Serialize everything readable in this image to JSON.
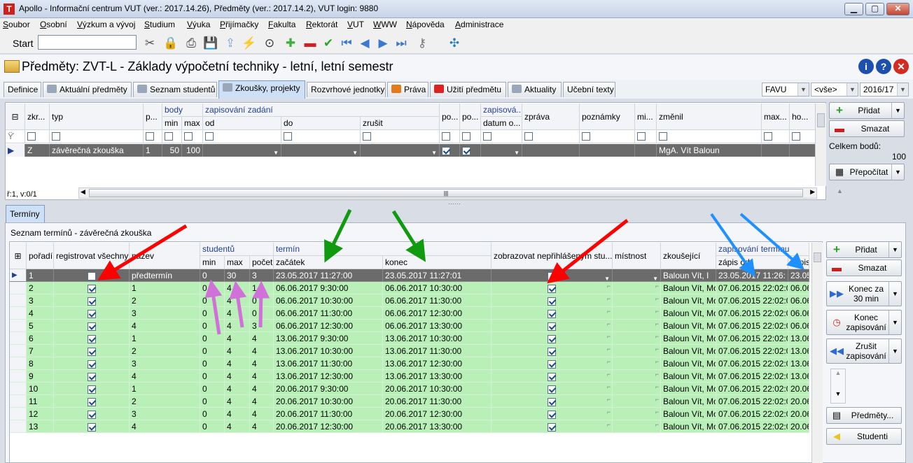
{
  "window": {
    "title": "Apollo - Informační centrum VUT  (ver.: 2017.14.26), Předměty (ver.: 2017.14.2), VUT login: 9880",
    "app_icon": "T"
  },
  "menu": [
    "Soubor",
    "Osobní",
    "Výzkum a vývoj",
    "Studium",
    "Výuka",
    "Přijímačky",
    "Fakulta",
    "Rektorát",
    "VUT",
    "WWW",
    "Nápověda",
    "Administrace"
  ],
  "toolbar": {
    "start_label": "Start",
    "start_value": "",
    "icons": [
      "tools-icon",
      "lock-icon",
      "printer-icon",
      "save-icon",
      "export-icon",
      "lightning-icon",
      "binoculars-icon",
      "add-icon",
      "remove-icon",
      "check-icon",
      "first-icon",
      "prev-icon",
      "next-icon",
      "last-icon",
      "key-icon",
      "network-icon"
    ]
  },
  "page": {
    "title": "Předměty: ZVT-L - Základy výpočetní techniky - letní, letní semestr"
  },
  "tabs": [
    "Definice",
    "Aktuální předměty",
    "Seznam studentů",
    "Zkoušky, projekty",
    "Rozvrhové jednotky",
    "Práva",
    "Užití předmětu",
    "Aktuality",
    "Učební texty"
  ],
  "active_tab": "Zkoušky, projekty",
  "filters": {
    "faculty": "FAVU",
    "all": "<vše>",
    "year": "2016/17"
  },
  "exam_grid": {
    "group_headers": {
      "body": "body",
      "zapisovani_zadani": "zapisování zadání",
      "zapisova": "zapisová..."
    },
    "columns": {
      "zkr": "zkr...",
      "typ": "typ",
      "p": "p...",
      "min": "min",
      "max": "max",
      "od": "od",
      "do": "do",
      "zrusit": "zrušit",
      "po1": "po...",
      "po2": "po...",
      "datum": "datum o...",
      "zprava": "zpráva",
      "poznamky": "poznámky",
      "mi": "mi...",
      "zmenil": "změnil",
      "maxb": "max...",
      "ho": "ho..."
    },
    "row": {
      "zkr": "Z",
      "typ": "závěrečná zkouška",
      "p": "1",
      "min": "50",
      "max": "100",
      "zmenil": "MgA. Vít Baloun"
    },
    "status": "ř:1, v:0/1"
  },
  "exam_side": {
    "add": "Přidat",
    "delete": "Smazat",
    "total_label": "Celkem bodů:",
    "total_value": "100",
    "recalc": "Přepočítat"
  },
  "terms_tab": "Termíny",
  "terms_title": "Seznam termínů - závěrečná zkouška",
  "terms_grid": {
    "group_headers": {
      "studentu": "studentů",
      "termin": "termín",
      "zapisovani": "zapisování termínu"
    },
    "columns": {
      "poradi": "pořadí",
      "registrovat": "registrovat všechny",
      "nazev": "název",
      "min": "min",
      "max": "max",
      "pocet": "počet",
      "zacatek": "začátek",
      "konec": "konec",
      "zobrazovat": "zobrazovat nepřihlášeným stu...",
      "mistnost": "místnost",
      "zkousejici": "zkoušející",
      "zapis_od": "zápis od",
      "zapis_do": "zápis"
    },
    "rows": [
      {
        "poradi": "1",
        "reg": false,
        "nazev": "předtermín",
        "min": "0",
        "max": "30",
        "pocet": "3",
        "zacatek": "23.05.2017 11:27:00",
        "konec": "23.05.2017 11:27:01",
        "zobr": false,
        "zkous": "Baloun Vít, I",
        "zapis_od": "23.05.2017 11:26:",
        "zapis_do": "23.05"
      },
      {
        "poradi": "2",
        "reg": true,
        "nazev": "1",
        "min": "0",
        "max": "4",
        "pocet": "1",
        "zacatek": "06.06.2017 9:30:00",
        "konec": "06.06.2017 10:30:00",
        "zobr": true,
        "zkous": "Baloun Vít, Mc",
        "zapis_od": "07.06.2015 22:02:00",
        "zapis_do": "06.06"
      },
      {
        "poradi": "3",
        "reg": true,
        "nazev": "2",
        "min": "0",
        "max": "4",
        "pocet": "0",
        "zacatek": "06.06.2017 10:30:00",
        "konec": "06.06.2017 11:30:00",
        "zobr": true,
        "zkous": "Baloun Vít, Mc",
        "zapis_od": "07.06.2015 22:02:00",
        "zapis_do": "06.06"
      },
      {
        "poradi": "4",
        "reg": true,
        "nazev": "3",
        "min": "0",
        "max": "4",
        "pocet": "0",
        "zacatek": "06.06.2017 11:30:00",
        "konec": "06.06.2017 12:30:00",
        "zobr": true,
        "zkous": "Baloun Vít, Mc",
        "zapis_od": "07.06.2015 22:02:00",
        "zapis_do": "06.06"
      },
      {
        "poradi": "5",
        "reg": true,
        "nazev": "4",
        "min": "0",
        "max": "4",
        "pocet": "3",
        "zacatek": "06.06.2017 12:30:00",
        "konec": "06.06.2017 13:30:00",
        "zobr": true,
        "zkous": "Baloun Vít, Mc",
        "zapis_od": "07.06.2015 22:02:00",
        "zapis_do": "06.06"
      },
      {
        "poradi": "6",
        "reg": true,
        "nazev": "1",
        "min": "0",
        "max": "4",
        "pocet": "4",
        "zacatek": "13.06.2017 9:30:00",
        "konec": "13.06.2017 10:30:00",
        "zobr": true,
        "zkous": "Baloun Vít, Mc",
        "zapis_od": "07.06.2015 22:02:00",
        "zapis_do": "13.06"
      },
      {
        "poradi": "7",
        "reg": true,
        "nazev": "2",
        "min": "0",
        "max": "4",
        "pocet": "4",
        "zacatek": "13.06.2017 10:30:00",
        "konec": "13.06.2017 11:30:00",
        "zobr": true,
        "zkous": "Baloun Vít, Mc",
        "zapis_od": "07.06.2015 22:02:00",
        "zapis_do": "13.06"
      },
      {
        "poradi": "8",
        "reg": true,
        "nazev": "3",
        "min": "0",
        "max": "4",
        "pocet": "4",
        "zacatek": "13.06.2017 11:30:00",
        "konec": "13.06.2017 12:30:00",
        "zobr": true,
        "zkous": "Baloun Vít, Mc",
        "zapis_od": "07.06.2015 22:02:00",
        "zapis_do": "13.06"
      },
      {
        "poradi": "9",
        "reg": true,
        "nazev": "4",
        "min": "0",
        "max": "4",
        "pocet": "4",
        "zacatek": "13.06.2017 12:30:00",
        "konec": "13.06.2017 13:30:00",
        "zobr": true,
        "zkous": "Baloun Vít, Mc",
        "zapis_od": "07.06.2015 22:02:00",
        "zapis_do": "13.06"
      },
      {
        "poradi": "10",
        "reg": true,
        "nazev": "1",
        "min": "0",
        "max": "4",
        "pocet": "4",
        "zacatek": "20.06.2017 9:30:00",
        "konec": "20.06.2017 10:30:00",
        "zobr": true,
        "zkous": "Baloun Vít, Mc",
        "zapis_od": "07.06.2015 22:02:00",
        "zapis_do": "20.06"
      },
      {
        "poradi": "11",
        "reg": true,
        "nazev": "2",
        "min": "0",
        "max": "4",
        "pocet": "4",
        "zacatek": "20.06.2017 10:30:00",
        "konec": "20.06.2017 11:30:00",
        "zobr": true,
        "zkous": "Baloun Vít, Mc",
        "zapis_od": "07.06.2015 22:02:00",
        "zapis_do": "20.06"
      },
      {
        "poradi": "12",
        "reg": true,
        "nazev": "3",
        "min": "0",
        "max": "4",
        "pocet": "4",
        "zacatek": "20.06.2017 11:30:00",
        "konec": "20.06.2017 12:30:00",
        "zobr": true,
        "zkous": "Baloun Vít, Mc",
        "zapis_od": "07.06.2015 22:02:00",
        "zapis_do": "20.06"
      },
      {
        "poradi": "13",
        "reg": true,
        "nazev": "4",
        "min": "0",
        "max": "4",
        "pocet": "4",
        "zacatek": "20.06.2017 12:30:00",
        "konec": "20.06.2017 13:30:00",
        "zobr": true,
        "zkous": "Baloun Vít, Mc",
        "zapis_od": "07.06.2015 22:02:00",
        "zapis_do": "20.06"
      }
    ]
  },
  "terms_side": {
    "add": "Přidat",
    "delete": "Smazat",
    "end30": "Konec za 30 min",
    "end_enroll": "Konec zapisování",
    "cancel_enroll": "Zrušit zapisování",
    "subjects": "Předměty...",
    "students": "Studenti"
  },
  "colors": {
    "accent": "#1f3f9a",
    "row_green": "#b8f0b8",
    "annotation_red": "#ff0000",
    "annotation_green": "#109a10",
    "annotation_blue": "#1e90ff",
    "annotation_purple": "#d070d8"
  }
}
